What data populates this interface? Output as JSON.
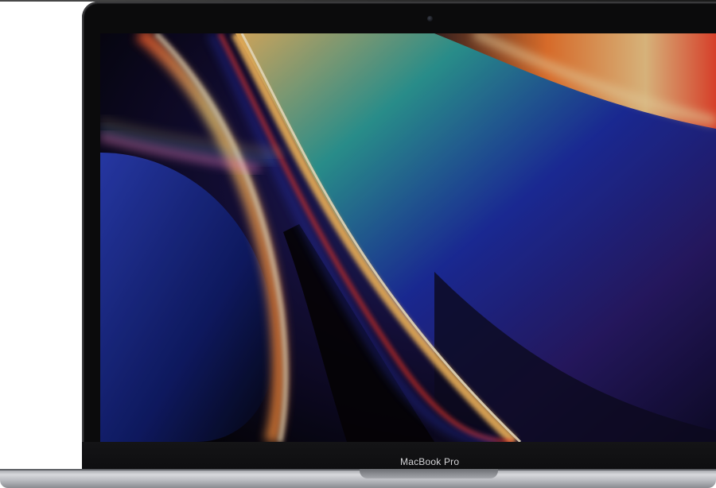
{
  "laptop": {
    "brand_label": "MacBook Pro"
  },
  "colors": {
    "bezel": "#0b0b0c",
    "base": "#c4c6ca",
    "wallpaper_blue": "#1d2fa8",
    "wallpaper_orange": "#f4a23a",
    "wallpaper_red": "#e23b2a",
    "wallpaper_teal": "#2fa7a0"
  }
}
